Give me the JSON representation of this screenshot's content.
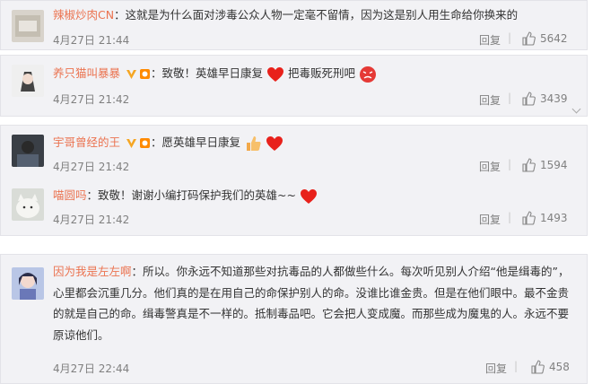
{
  "comments": [
    {
      "user": "辣椒炒肉CN",
      "text": "：这就是为什么面对涉毒公众人物一定毫不留情，因为这是别人用生命给你换来的",
      "time": "4月27日 21:44",
      "reply": "回复",
      "likes": "5642"
    },
    {
      "user": "养只猫叫暴暴",
      "text1": "：致敬！英雄早日康复",
      "text2": "把毒贩死刑吧",
      "time": "4月27日 21:42",
      "reply": "回复",
      "likes": "3439"
    },
    {
      "user": "宇哥曾经的王",
      "text": "：愿英雄早日康复",
      "time": "4月27日 21:42",
      "reply": "回复",
      "likes": "1594"
    },
    {
      "user": "喵圆吗",
      "text": "：致敬！谢谢小编打码保护我们的英雄~~",
      "time": "4月27日 21:42",
      "reply": "回复",
      "likes": "1493"
    },
    {
      "user": "因为我是左左啊",
      "text": "：所以。你永远不知道那些对抗毒品的人都做些什么。每次听见别人介绍“他是缉毒的”，心里都会沉重几分。他们真的是在用自己的命保护别人的命。没谁比谁金贵。但是在他们眼中。最不金贵的就是自己的命。缉毒警真是不一样的。抵制毒品吧。它会把人变成魔。而那些成为魔鬼的人。永远不要原谅他们。",
      "time": "4月27日 22:44",
      "reply": "回复",
      "likes": "458"
    }
  ],
  "colors": {
    "username": "#eb7350",
    "meta": "#808080",
    "card_bg": "#f2f2f5",
    "heart": "#e8211b"
  },
  "icons": [
    "thumbs-up-icon",
    "heart-emoji",
    "angry-face-emoji",
    "thumbs-up-emoji",
    "verified-v-icon",
    "fan-badge-icon"
  ]
}
